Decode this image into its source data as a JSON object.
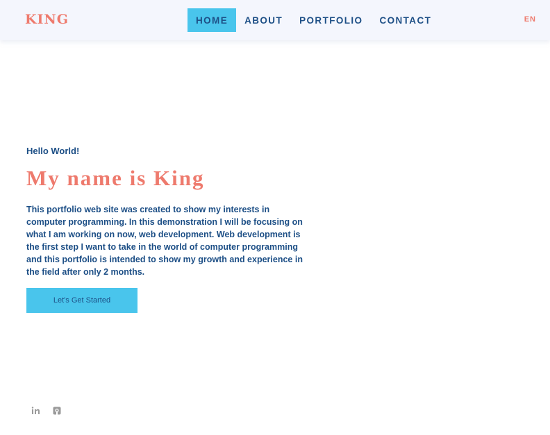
{
  "header": {
    "logo": "KING",
    "nav": [
      {
        "label": "HOME",
        "active": true
      },
      {
        "label": "ABOUT",
        "active": false
      },
      {
        "label": "PORTFOLIO",
        "active": false
      },
      {
        "label": "CONTACT",
        "active": false
      }
    ],
    "language": "EN"
  },
  "hero": {
    "greeting": "Hello World!",
    "title": "My name is King",
    "intro": "This portfolio web site was created to show my interests in computer programming. In this demonstration I will be focusing on what I am working on now, web development. Web development is the first step I want to take in the world of computer programming and this portfolio is intended to show my growth and experience in the field after only 2 months.",
    "cta_label": "Let's Get Started"
  },
  "social": {
    "links": [
      {
        "icon": "linkedin-icon"
      },
      {
        "icon": "github-icon"
      }
    ]
  },
  "colors": {
    "accent": "#ee7a6d",
    "primary_text": "#1d4f86",
    "highlight": "#49c5ec",
    "header_bg": "#f4f6fd",
    "icon": "#9a9a9a"
  }
}
